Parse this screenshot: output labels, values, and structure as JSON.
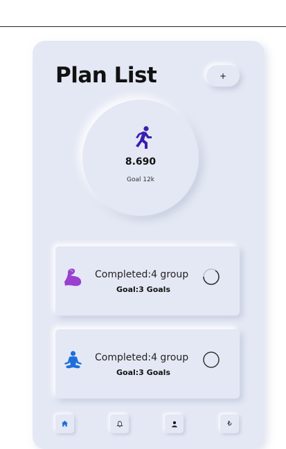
{
  "page": {
    "title": "Plan List",
    "add_label": "+"
  },
  "summary": {
    "steps": "8.690",
    "goal": "Goal 12k",
    "icon": "running-person-icon"
  },
  "plans": [
    {
      "icon": "flexed-biceps-icon",
      "completed": "Completed:4 group",
      "goal": "Goal:3 Goals",
      "accent": "#9a3fd0",
      "status": "in-progress"
    },
    {
      "icon": "meditation-person-icon",
      "completed": "Completed:4 group",
      "goal": "Goal:3 Goals",
      "accent": "#1e6fd9",
      "status": "not-started"
    }
  ],
  "nav": [
    {
      "name": "home",
      "icon": "home-icon",
      "active": true,
      "color": "#1e6fd9"
    },
    {
      "name": "notifications",
      "icon": "bell-icon",
      "active": false
    },
    {
      "name": "profile",
      "icon": "person-icon",
      "active": false
    },
    {
      "name": "lira",
      "icon": "lira-icon",
      "label": "₺",
      "active": false
    }
  ],
  "colors": {
    "background": "#e4e8f4",
    "runner": "#3a1fae"
  }
}
